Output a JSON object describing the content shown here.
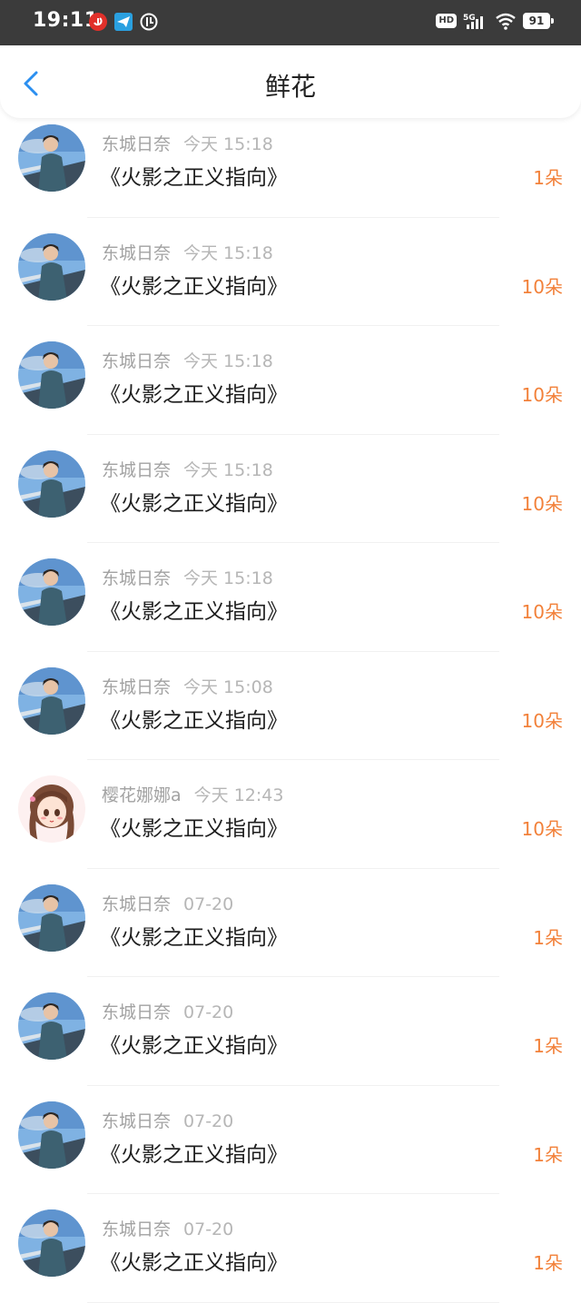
{
  "status_bar": {
    "time": "19:11",
    "network": "5G",
    "hd": "HD",
    "battery": "91"
  },
  "header": {
    "title": "鲜花"
  },
  "colors": {
    "accent_orange": "#f2813a",
    "back_blue": "#2b8ff0"
  },
  "rows": [
    {
      "user": "东城日奈",
      "time": "今天 15:18",
      "work": "《火影之正义指向》",
      "count": "1朵"
    },
    {
      "user": "东城日奈",
      "time": "今天 15:18",
      "work": "《火影之正义指向》",
      "count": "10朵"
    },
    {
      "user": "东城日奈",
      "time": "今天 15:18",
      "work": "《火影之正义指向》",
      "count": "10朵"
    },
    {
      "user": "东城日奈",
      "time": "今天 15:18",
      "work": "《火影之正义指向》",
      "count": "10朵"
    },
    {
      "user": "东城日奈",
      "time": "今天 15:18",
      "work": "《火影之正义指向》",
      "count": "10朵"
    },
    {
      "user": "东城日奈",
      "time": "今天 15:08",
      "work": "《火影之正义指向》",
      "count": "10朵"
    },
    {
      "user": "樱花娜娜a",
      "time": "今天 12:43",
      "work": "《火影之正义指向》",
      "count": "10朵"
    },
    {
      "user": "东城日奈",
      "time": "07-20",
      "work": "《火影之正义指向》",
      "count": "1朵"
    },
    {
      "user": "东城日奈",
      "time": "07-20",
      "work": "《火影之正义指向》",
      "count": "1朵"
    },
    {
      "user": "东城日奈",
      "time": "07-20",
      "work": "《火影之正义指向》",
      "count": "1朵"
    },
    {
      "user": "东城日奈",
      "time": "07-20",
      "work": "《火影之正义指向》",
      "count": "1朵"
    }
  ]
}
